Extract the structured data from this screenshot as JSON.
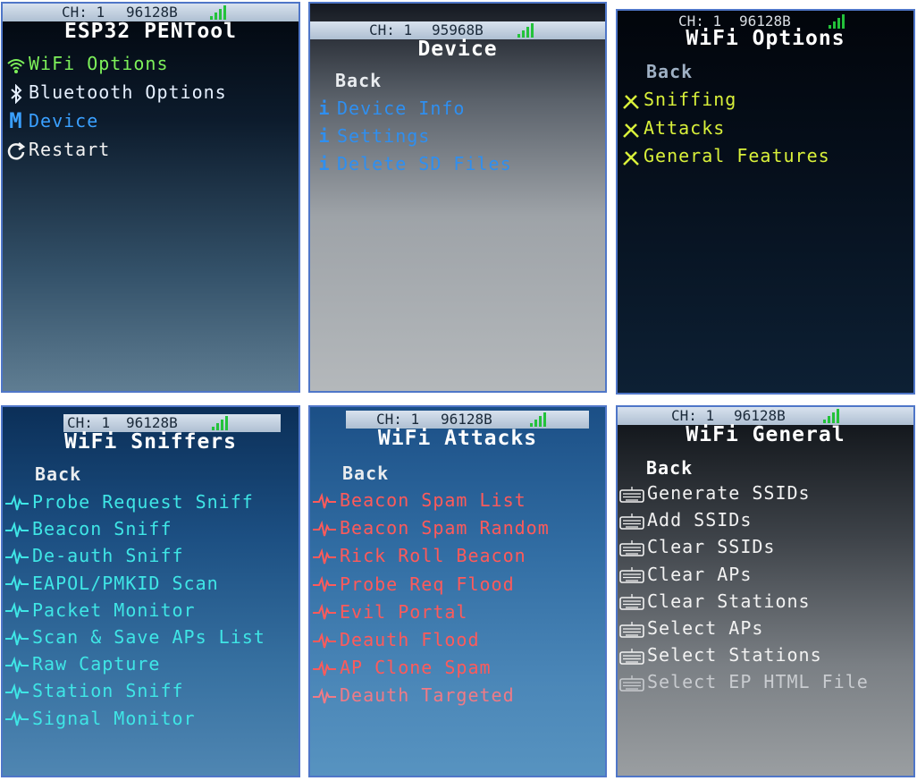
{
  "status": {
    "ch": "CH: 1",
    "mem_a": "96128B",
    "mem_b": "95968B"
  },
  "colors": {
    "green": "#7df05a",
    "cyan": "#3fe6e6",
    "blue": "#2f8ff0",
    "yellow": "#d9f03a",
    "red": "#ff5a5a",
    "white": "#f2f2f2"
  },
  "panel1": {
    "title": "ESP32 PENTool",
    "items": [
      {
        "label": "WiFi Options",
        "icon": "wifi-icon"
      },
      {
        "label": "Bluetooth Options",
        "icon": "bluetooth-icon"
      },
      {
        "label": "Device",
        "icon": "device-m-icon"
      },
      {
        "label": "Restart",
        "icon": "restart-icon"
      }
    ]
  },
  "panel2": {
    "title": "Device",
    "back": "Back",
    "items": [
      {
        "label": "Device Info",
        "icon": "info-icon"
      },
      {
        "label": "Settings",
        "icon": "info-icon"
      },
      {
        "label": "Delete SD Files",
        "icon": "info-icon"
      }
    ]
  },
  "panel3": {
    "title": "WiFi Options",
    "back": "Back",
    "items": [
      {
        "label": "Sniffing",
        "icon": "tools-icon"
      },
      {
        "label": "Attacks",
        "icon": "tools-icon"
      },
      {
        "label": "General Features",
        "icon": "tools-icon"
      }
    ]
  },
  "panel4": {
    "title": "WiFi Sniffers",
    "back": "Back",
    "items": [
      "Probe Request Sniff",
      "Beacon Sniff",
      "De-auth Sniff",
      "EAPOL/PMKID Scan",
      "Packet Monitor",
      "Scan & Save APs List",
      "Raw Capture",
      "Station Sniff",
      "Signal Monitor"
    ]
  },
  "panel5": {
    "title": "WiFi Attacks",
    "back": "Back",
    "items": [
      "Beacon Spam List",
      "Beacon Spam Random",
      "Rick Roll Beacon",
      "Probe Req Flood",
      "Evil Portal",
      "Deauth Flood",
      "AP Clone Spam",
      "Deauth Targeted"
    ]
  },
  "panel6": {
    "title": "WiFi General",
    "back": "Back",
    "items": [
      "Generate SSIDs",
      "Add SSIDs",
      "Clear SSIDs",
      "Clear APs",
      "Clear Stations",
      "Select APs",
      "Select Stations",
      "Select EP HTML File"
    ]
  }
}
